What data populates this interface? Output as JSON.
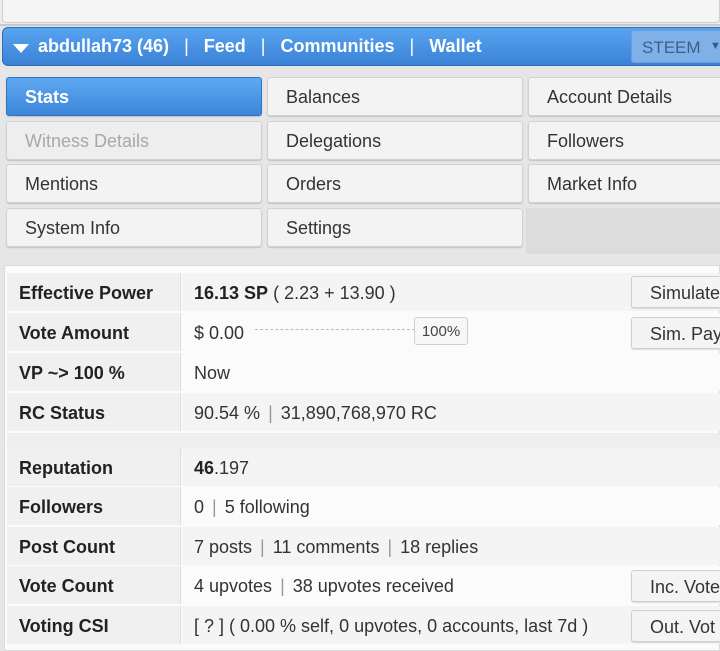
{
  "header": {
    "account": "abdullah73 (46)",
    "links": [
      "Feed",
      "Communities",
      "Wallet"
    ],
    "separator": "|",
    "currency_select": "STEEM",
    "select_arrow": "▼",
    "accent": "#3b82d6"
  },
  "tabs": [
    {
      "label": "Stats",
      "state": "active"
    },
    {
      "label": "Balances",
      "state": "normal"
    },
    {
      "label": "Account Details",
      "state": "normal"
    },
    {
      "label": "Witness Details",
      "state": "disabled"
    },
    {
      "label": "Delegations",
      "state": "normal"
    },
    {
      "label": "Followers",
      "state": "normal"
    },
    {
      "label": "Mentions",
      "state": "normal"
    },
    {
      "label": "Orders",
      "state": "normal"
    },
    {
      "label": "Market Info",
      "state": "normal"
    },
    {
      "label": "System Info",
      "state": "normal"
    },
    {
      "label": "Settings",
      "state": "normal"
    }
  ],
  "stats": {
    "effective_power": {
      "label": "Effective Power",
      "value": "16.13 SP",
      "detail": "( 2.23 + 13.90 )",
      "button": "Simulate"
    },
    "vote_amount": {
      "label": "Vote Amount",
      "value": "$ 0.00",
      "slider": "100%",
      "slider_fraction": 1.0,
      "button": "Sim. Payo"
    },
    "vp": {
      "label": "VP ~> 100 %",
      "value": "Now"
    },
    "rc": {
      "label": "RC Status",
      "percent": "90.54 %",
      "amount": "31,890,768,970 RC"
    },
    "reputation": {
      "label": "Reputation",
      "int": "46",
      "frac": ".197"
    },
    "followers": {
      "label": "Followers",
      "followers": "0",
      "following": "5 following"
    },
    "post_count": {
      "label": "Post Count",
      "posts": "7 posts",
      "comments": "11 comments",
      "replies": "18 replies"
    },
    "vote_count": {
      "label": "Vote Count",
      "upvotes": "4 upvotes",
      "received": "38 upvotes received",
      "button": "Inc. Vote"
    },
    "voting_csi": {
      "label": "Voting CSI",
      "value": "[ ? ] ( 0.00 % self, 0 upvotes, 0 accounts, last 7d )",
      "button": "Out. Vot"
    }
  },
  "pipe": "|"
}
